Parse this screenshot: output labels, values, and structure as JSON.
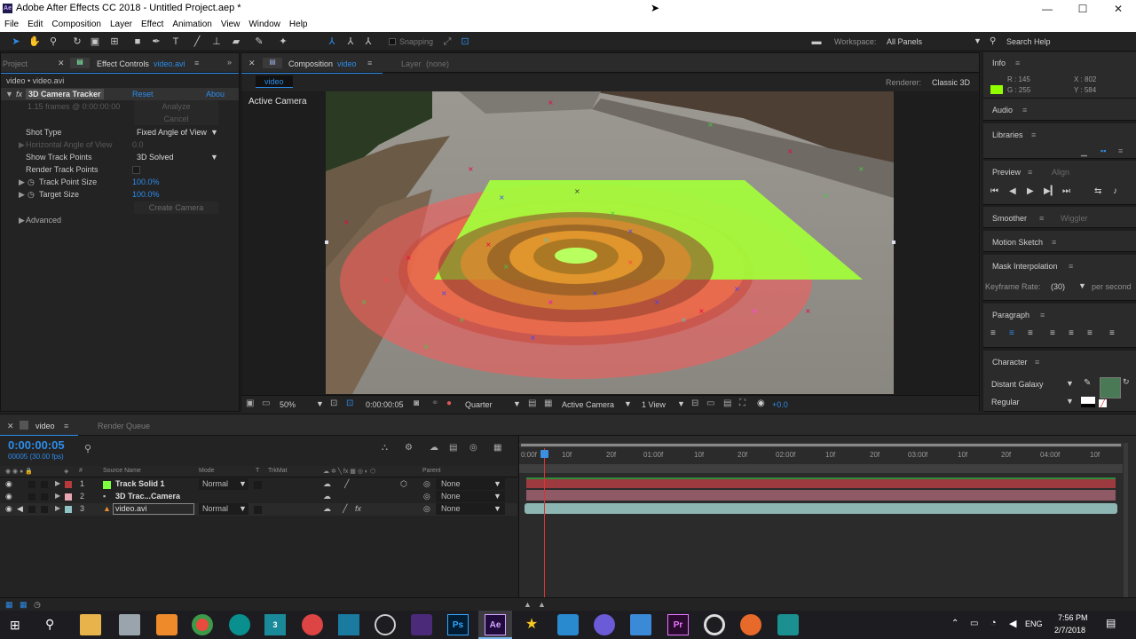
{
  "window": {
    "title": "Adobe After Effects CC 2018 - Untitled Project.aep *"
  },
  "menu": [
    "File",
    "Edit",
    "Composition",
    "Layer",
    "Effect",
    "Animation",
    "View",
    "Window",
    "Help"
  ],
  "toolbar": {
    "snapping": "Snapping",
    "workspace_label": "Workspace:",
    "workspace_value": "All Panels",
    "search_placeholder": "Search Help"
  },
  "effect_panel": {
    "project_tab": "Project",
    "tab": "Effect Controls",
    "tab_file": "video.avi",
    "breadcrumb": "video • video.avi",
    "effect_name": "3D Camera Tracker",
    "reset": "Reset",
    "about": "Abou",
    "frames_info": "1.15 frames @ 0:00:00:00",
    "analyze": "Analyze",
    "cancel": "Cancel",
    "shot_type_label": "Shot Type",
    "shot_type_value": "Fixed Angle of View",
    "hav_label": "Horizontal Angle of View",
    "hav_value": "0.0",
    "show_points_label": "Show Track Points",
    "show_points_value": "3D Solved",
    "render_points_label": "Render Track Points",
    "point_size_label": "Track Point Size",
    "point_size_value": "100.0%",
    "target_size_label": "Target Size",
    "target_size_value": "100.0%",
    "create_camera": "Create Camera",
    "advanced": "Advanced"
  },
  "comp_panel": {
    "tab": "Composition",
    "tab_comp": "video",
    "layer_tab": "Layer",
    "layer_value": "(none)",
    "subtab": "video",
    "renderer_label": "Renderer:",
    "renderer_value": "Classic 3D",
    "camera_label": "Active Camera",
    "zoom": "50%",
    "timecode": "0:00:00:05",
    "resolution": "Quarter",
    "view_camera": "Active Camera",
    "views": "1 View",
    "exposure": "+0.0"
  },
  "right_panel": {
    "info": "Info",
    "r_value": "R : 145",
    "g_value": "G : 255",
    "x_value": "X : 802",
    "y_value": "Y : 584",
    "audio": "Audio",
    "libraries": "Libraries",
    "preview": "Preview",
    "align": "Align",
    "smoother": "Smoother",
    "wiggler": "Wiggler",
    "motion_sketch": "Motion Sketch",
    "mask_interp": "Mask Interpolation",
    "keyframe_rate_label": "Keyframe Rate:",
    "keyframe_rate_value": "(30)",
    "per_second": "per second",
    "paragraph": "Paragraph",
    "character": "Character",
    "font": "Distant Galaxy",
    "font_style": "Regular",
    "swatch_color": "#4a7a55"
  },
  "timeline": {
    "tab": "video",
    "render_queue": "Render Queue",
    "timecode": "0:00:00:05",
    "frame_info": "00005 (30.00 fps)",
    "col_source": "Source Name",
    "col_mode": "Mode",
    "col_t": "T",
    "col_trkmat": "TrkMat",
    "col_parent": "Parent",
    "ruler": [
      "0:00f",
      "10f",
      "20f",
      "01:00f",
      "10f",
      "20f",
      "02:00f",
      "10f",
      "20f",
      "03:00f",
      "10f",
      "20f",
      "04:00f",
      "10f"
    ],
    "layers": [
      {
        "num": "1",
        "name": "Track Solid 1",
        "mode": "Normal",
        "parent": "None",
        "color": "#b8393a",
        "bar": "#9c3a3f"
      },
      {
        "num": "2",
        "name": "3D Trac...Camera",
        "mode": "",
        "parent": "None",
        "color": "#e8a6b4",
        "bar": "#8f5a66"
      },
      {
        "num": "3",
        "name": "video.avi",
        "mode": "Normal",
        "parent": "None",
        "color": "#8fc3c4",
        "bar": "#8db5b2"
      }
    ]
  },
  "taskbar": {
    "time": "7:56 PM",
    "date": "2/7/2018",
    "lang": "ENG"
  },
  "colors": {
    "accent": "#2d8ceb",
    "solid_green": "#a3ff3a",
    "target_red": "#ff5050"
  }
}
